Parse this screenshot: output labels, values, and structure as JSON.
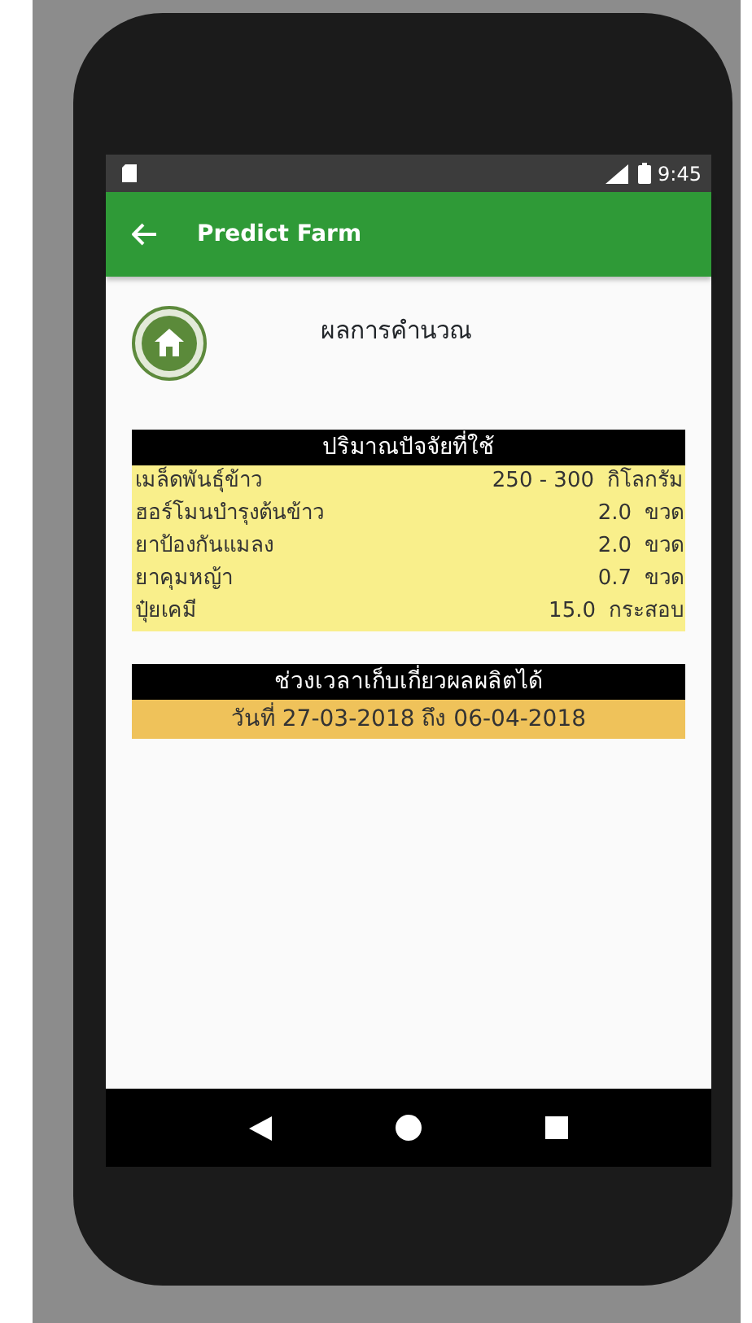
{
  "status_bar": {
    "time": "9:45"
  },
  "app_bar": {
    "title": "Predict Farm"
  },
  "page_title": "ผลการคำนวณ",
  "sections": [
    {
      "kind": "table",
      "title": "ปริมาณปัจจัยที่ใช้",
      "rows": [
        {
          "label": "เมล็ดพันธุ์ข้าว",
          "amount": "250 - 300",
          "unit": "กิโลกรัม"
        },
        {
          "label": "ฮอร์โมนบำรุงต้นข้าว",
          "amount": "2.0",
          "unit": "ขวด"
        },
        {
          "label": "ยาป้องกันแมลง",
          "amount": "2.0",
          "unit": "ขวด"
        },
        {
          "label": "ยาคุมหญ้า",
          "amount": "0.7",
          "unit": "ขวด"
        },
        {
          "label": "ปุ๋ยเคมี",
          "amount": "15.0",
          "unit": "กระสอบ"
        }
      ]
    },
    {
      "kind": "range",
      "title": "ช่วงเวลาเก็บเกี่ยวผลผลิตได้",
      "text": "วันที่ 27-03-2018 ถึง 06-04-2018"
    }
  ]
}
